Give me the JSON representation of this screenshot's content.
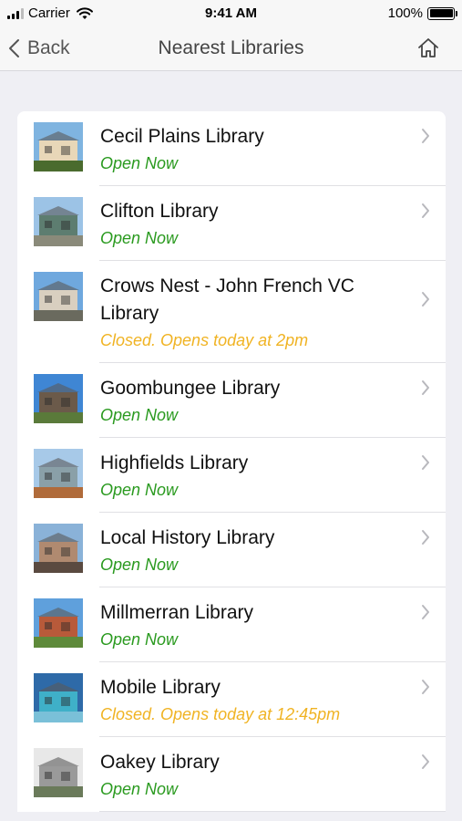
{
  "status_bar": {
    "carrier": "Carrier",
    "time": "9:41 AM",
    "battery": "100%"
  },
  "nav": {
    "back_label": "Back",
    "title": "Nearest Libraries"
  },
  "colors": {
    "open": "#2a9a1f",
    "closed": "#f0b323"
  },
  "libraries": [
    {
      "name": "Cecil Plains Library",
      "status": "Open Now",
      "open": true,
      "thumb": [
        "#7fb4e0",
        "#e8d7b8",
        "#4a6b2e"
      ]
    },
    {
      "name": "Clifton Library",
      "status": "Open Now",
      "open": true,
      "thumb": [
        "#9cc3e6",
        "#5d7d70",
        "#8a8a7a"
      ]
    },
    {
      "name": "Crows Nest - John French VC Library",
      "status": "Closed. Opens today at 2pm",
      "open": false,
      "thumb": [
        "#6fa8de",
        "#d9cfc0",
        "#6a6a5e"
      ]
    },
    {
      "name": "Goombungee Library",
      "status": "Open Now",
      "open": true,
      "thumb": [
        "#3f86d4",
        "#6b5a4a",
        "#5a7a3a"
      ]
    },
    {
      "name": "Highfields Library",
      "status": "Open Now",
      "open": true,
      "thumb": [
        "#a7c9e8",
        "#8aa0a8",
        "#b06b3a"
      ]
    },
    {
      "name": "Local History Library",
      "status": "Open Now",
      "open": true,
      "thumb": [
        "#8ab2d8",
        "#b08a70",
        "#5a4a40"
      ]
    },
    {
      "name": "Millmerran Library",
      "status": "Open Now",
      "open": true,
      "thumb": [
        "#5fa0dc",
        "#b85a3a",
        "#5e8a3a"
      ]
    },
    {
      "name": "Mobile Library",
      "status": "Closed. Opens today at 12:45pm",
      "open": false,
      "thumb": [
        "#2e6aa8",
        "#3fb0c8",
        "#7ac0d8"
      ]
    },
    {
      "name": "Oakey Library",
      "status": "Open Now",
      "open": true,
      "thumb": [
        "#e8e8e8",
        "#9a9a9a",
        "#6a7a5a"
      ]
    }
  ]
}
